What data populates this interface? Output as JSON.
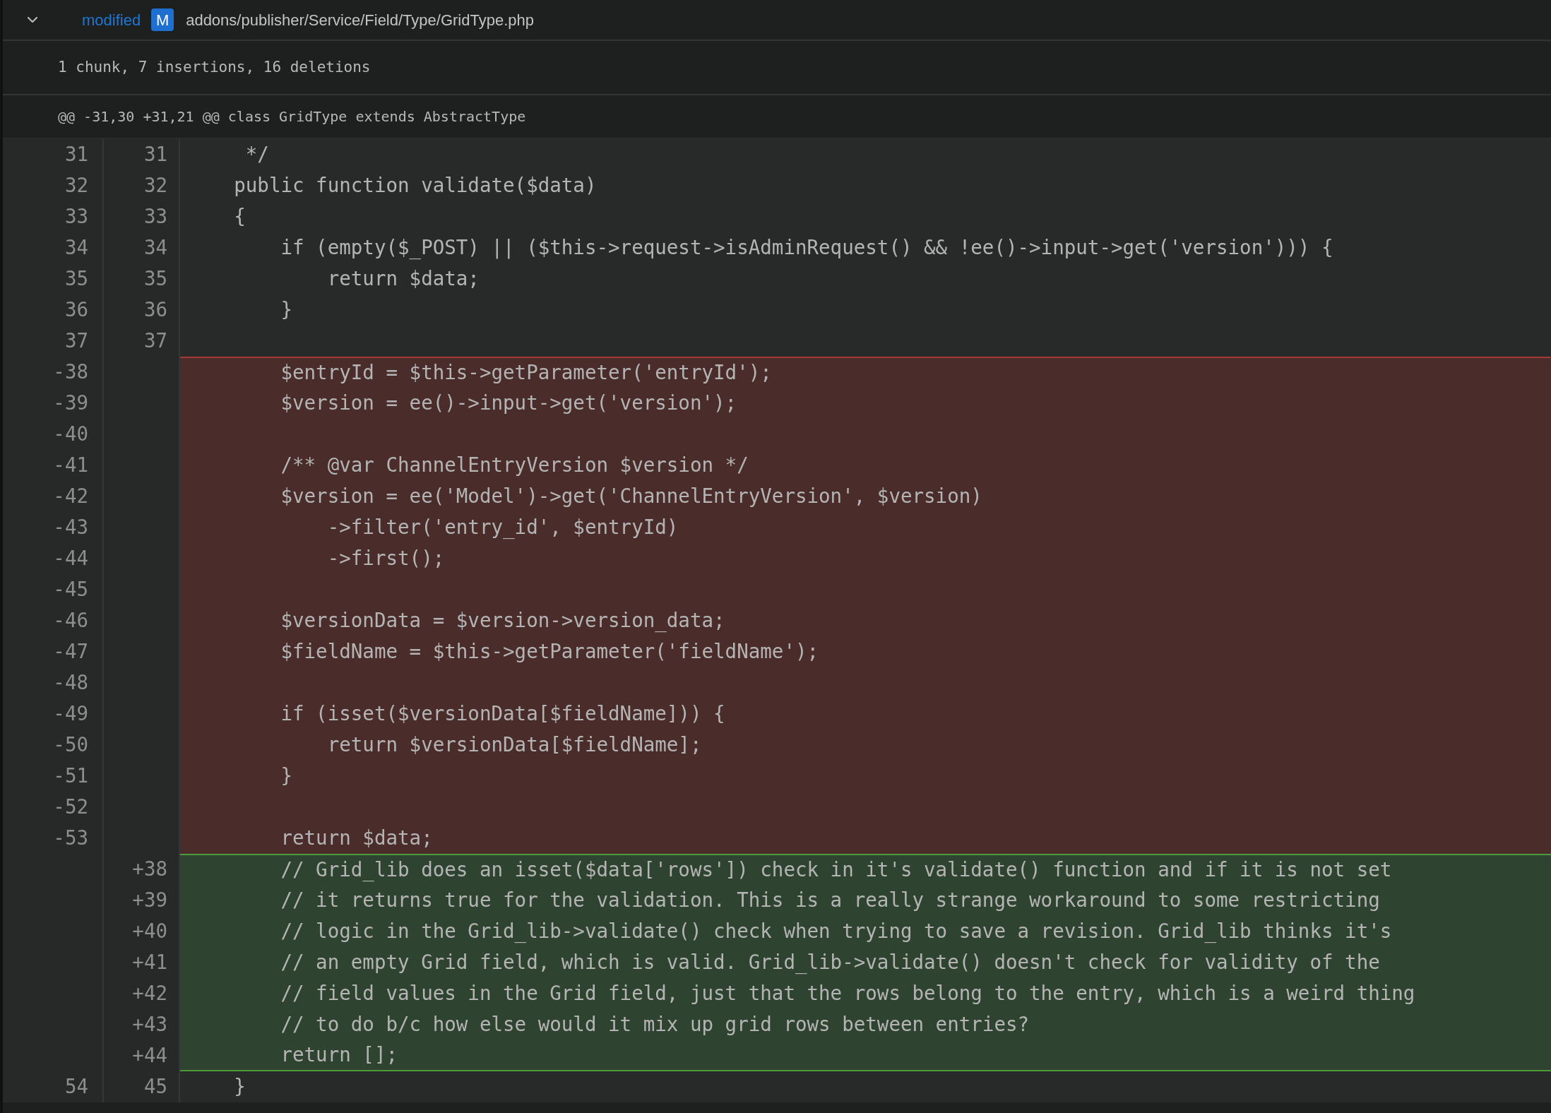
{
  "file_header": {
    "expanded": true,
    "status": "modified",
    "badge": "M",
    "path": "addons/publisher/Service/Field/Type/GridType.php"
  },
  "summary": "1 chunk, 7 insertions, 16 deletions",
  "hunk_header": "@@ -31,30 +31,21 @@ class GridType extends AbstractType",
  "lines": [
    {
      "kind": "context",
      "old": "31",
      "new": "31",
      "text": "     */"
    },
    {
      "kind": "context",
      "old": "32",
      "new": "32",
      "text": "    public function validate($data)"
    },
    {
      "kind": "context",
      "old": "33",
      "new": "33",
      "text": "    {"
    },
    {
      "kind": "context",
      "old": "34",
      "new": "34",
      "text": "        if (empty($_POST) || ($this->request->isAdminRequest() && !ee()->input->get('version'))) {"
    },
    {
      "kind": "context",
      "old": "35",
      "new": "35",
      "text": "            return $data;"
    },
    {
      "kind": "context",
      "old": "36",
      "new": "36",
      "text": "        }"
    },
    {
      "kind": "context",
      "old": "37",
      "new": "37"
    },
    {
      "kind": "deleted",
      "old": "-38",
      "text": "        $entryId = $this->getParameter('entryId');"
    },
    {
      "kind": "deleted",
      "old": "-39",
      "text": "        $version = ee()->input->get('version');"
    },
    {
      "kind": "deleted",
      "old": "-40"
    },
    {
      "kind": "deleted",
      "old": "-41",
      "text": "        /** @var ChannelEntryVersion $version */"
    },
    {
      "kind": "deleted",
      "old": "-42",
      "text": "        $version = ee('Model')->get('ChannelEntryVersion', $version)"
    },
    {
      "kind": "deleted",
      "old": "-43",
      "text": "            ->filter('entry_id', $entryId)"
    },
    {
      "kind": "deleted",
      "old": "-44",
      "text": "            ->first();"
    },
    {
      "kind": "deleted",
      "old": "-45"
    },
    {
      "kind": "deleted",
      "old": "-46",
      "text": "        $versionData = $version->version_data;"
    },
    {
      "kind": "deleted",
      "old": "-47",
      "text": "        $fieldName = $this->getParameter('fieldName');"
    },
    {
      "kind": "deleted",
      "old": "-48"
    },
    {
      "kind": "deleted",
      "old": "-49",
      "text": "        if (isset($versionData[$fieldName])) {"
    },
    {
      "kind": "deleted",
      "old": "-50",
      "text": "            return $versionData[$fieldName];"
    },
    {
      "kind": "deleted",
      "old": "-51",
      "text": "        }"
    },
    {
      "kind": "deleted",
      "old": "-52"
    },
    {
      "kind": "deleted",
      "old": "-53",
      "text": "        return $data;"
    },
    {
      "kind": "added",
      "new": "+38",
      "text": "        // Grid_lib does an isset($data['rows']) check in it's validate() function and if it is not set"
    },
    {
      "kind": "added",
      "new": "+39",
      "text": "        // it returns true for the validation. This is a really strange workaround to some restricting"
    },
    {
      "kind": "added",
      "new": "+40",
      "text": "        // logic in the Grid_lib->validate() check when trying to save a revision. Grid_lib thinks it's"
    },
    {
      "kind": "added",
      "new": "+41",
      "text": "        // an empty Grid field, which is valid. Grid_lib->validate() doesn't check for validity of the"
    },
    {
      "kind": "added",
      "new": "+42",
      "text": "        // field values in the Grid field, just that the rows belong to the entry, which is a weird thing"
    },
    {
      "kind": "added",
      "new": "+43",
      "text": "        // to do b/c how else would it mix up grid rows between entries?"
    },
    {
      "kind": "added",
      "new": "+44",
      "text": "        return [];"
    },
    {
      "kind": "context",
      "old": "54",
      "new": "45",
      "text": "    }"
    }
  ]
}
